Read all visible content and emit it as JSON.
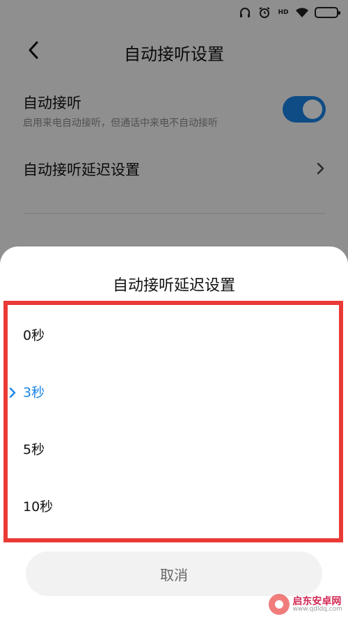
{
  "status_bar": {
    "icons": [
      "headset-icon",
      "alarm-icon",
      "hd-badge",
      "wifi-icon",
      "battery-icon"
    ],
    "hd_label": "HD",
    "battery_color": "#e8a320"
  },
  "navbar": {
    "title": "自动接听设置"
  },
  "settings": {
    "auto_answer": {
      "title": "自动接听",
      "subtitle": "启用来电自动接听，但通话中来电不自动接听",
      "enabled": true,
      "toggle_color": "#1a84e6"
    },
    "delay_row": {
      "title": "自动接听延迟设置"
    }
  },
  "sheet": {
    "title": "自动接听延迟设置",
    "options": [
      {
        "label": "0秒",
        "selected": false
      },
      {
        "label": "3秒",
        "selected": true
      },
      {
        "label": "5秒",
        "selected": false
      },
      {
        "label": "10秒",
        "selected": false
      }
    ],
    "cancel_label": "取消",
    "selected_color": "#1a84e6",
    "highlight_color": "#ea3a36"
  },
  "watermark": {
    "name": "启东安卓网",
    "url": "www.qdldq.com"
  }
}
